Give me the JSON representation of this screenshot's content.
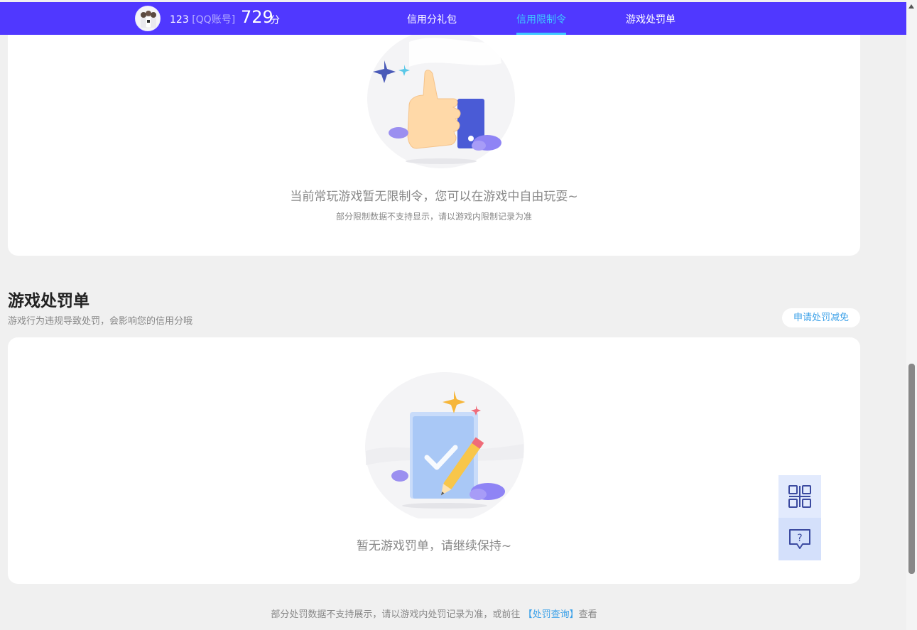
{
  "header": {
    "user_id": "123",
    "account_type": "[QQ账号]",
    "credit_score": "729",
    "score_unit": "分",
    "tabs": [
      {
        "label": "信用分礼包",
        "active": false
      },
      {
        "label": "信用限制令",
        "active": true
      },
      {
        "label": "游戏处罚单",
        "active": false
      }
    ]
  },
  "restriction": {
    "message": "当前常玩游戏暂无限制令，您可以在游戏中自由玩耍~",
    "note": "部分限制数据不支持显示，请以游戏内限制记录为准"
  },
  "penalty": {
    "title": "游戏处罚单",
    "description": "游戏行为违规导致处罚，会影响您的信用分哦",
    "apply_button": "申请处罚减免",
    "message": "暂无游戏罚单，请继续保持~"
  },
  "footer": {
    "note_prefix": "部分处罚数据不支持展示，请以游戏内处罚记录为准，或前往",
    "link_text": "【处罚查询】",
    "note_suffix": "查看"
  },
  "colors": {
    "header_bg": "#5038ff",
    "active_tab": "#3ec8ff",
    "link": "#3aa0e8",
    "page_bg": "#f0f0f0"
  },
  "icons": {
    "float_top": "qr-code-icon",
    "float_bottom": "help-chat-icon"
  }
}
